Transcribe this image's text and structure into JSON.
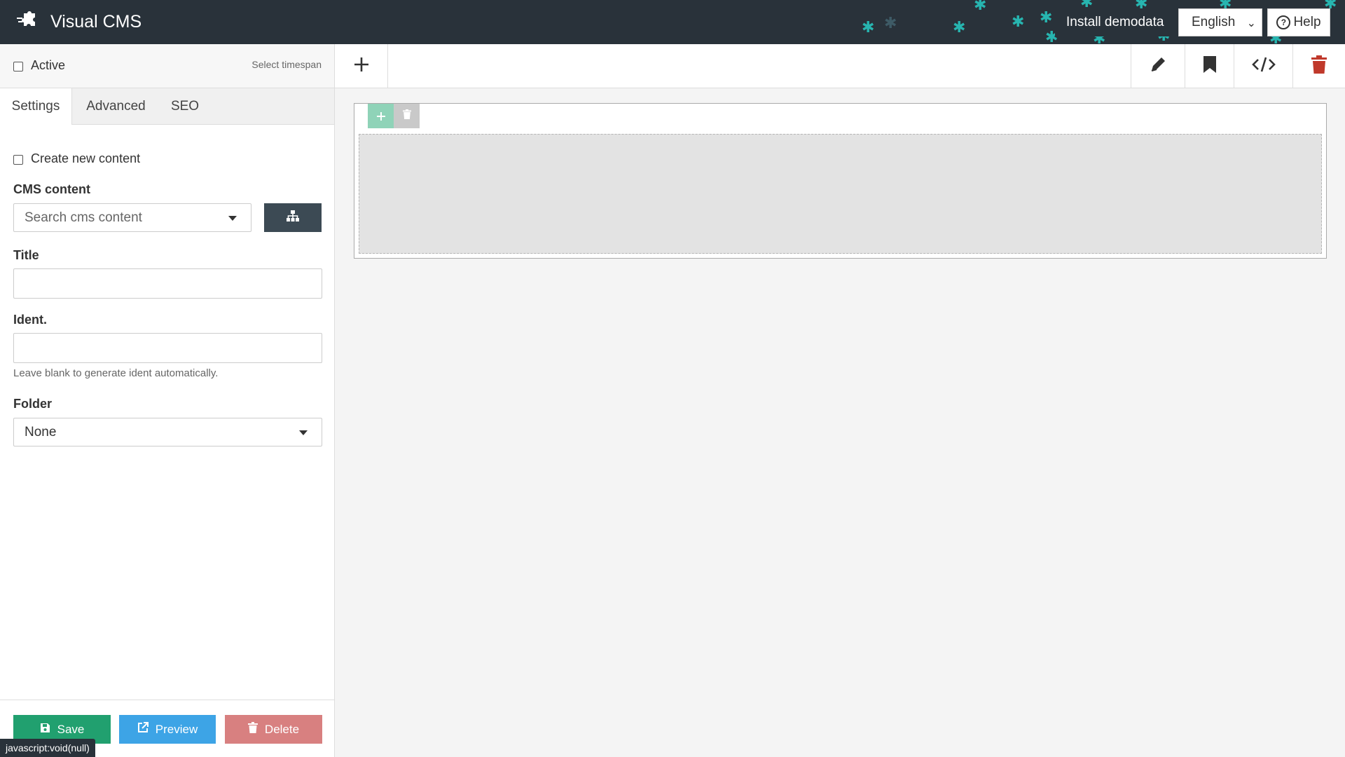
{
  "app": {
    "title": "Visual CMS"
  },
  "header": {
    "install_label": "Install demodata",
    "language": "English",
    "help_label": "Help"
  },
  "sidebar": {
    "active_label": "Active",
    "timespan_label": "Select timespan",
    "tabs": [
      {
        "label": "Settings",
        "active": true
      },
      {
        "label": "Advanced",
        "active": false
      },
      {
        "label": "SEO",
        "active": false
      }
    ],
    "create_new_label": "Create new content",
    "cms_content_label": "CMS content",
    "cms_content_placeholder": "Search cms content",
    "title_label": "Title",
    "title_value": "",
    "ident_label": "Ident.",
    "ident_value": "",
    "ident_help": "Leave blank to generate ident automatically.",
    "folder_label": "Folder",
    "folder_value": "None",
    "save_label": "Save",
    "preview_label": "Preview",
    "delete_label": "Delete"
  },
  "status_tip": "javascript:void(null)",
  "colors": {
    "topbar": "#29323a",
    "save": "#21a06f",
    "preview": "#3da4e6",
    "delete": "#d88080",
    "trash_icon": "#c0392b"
  }
}
